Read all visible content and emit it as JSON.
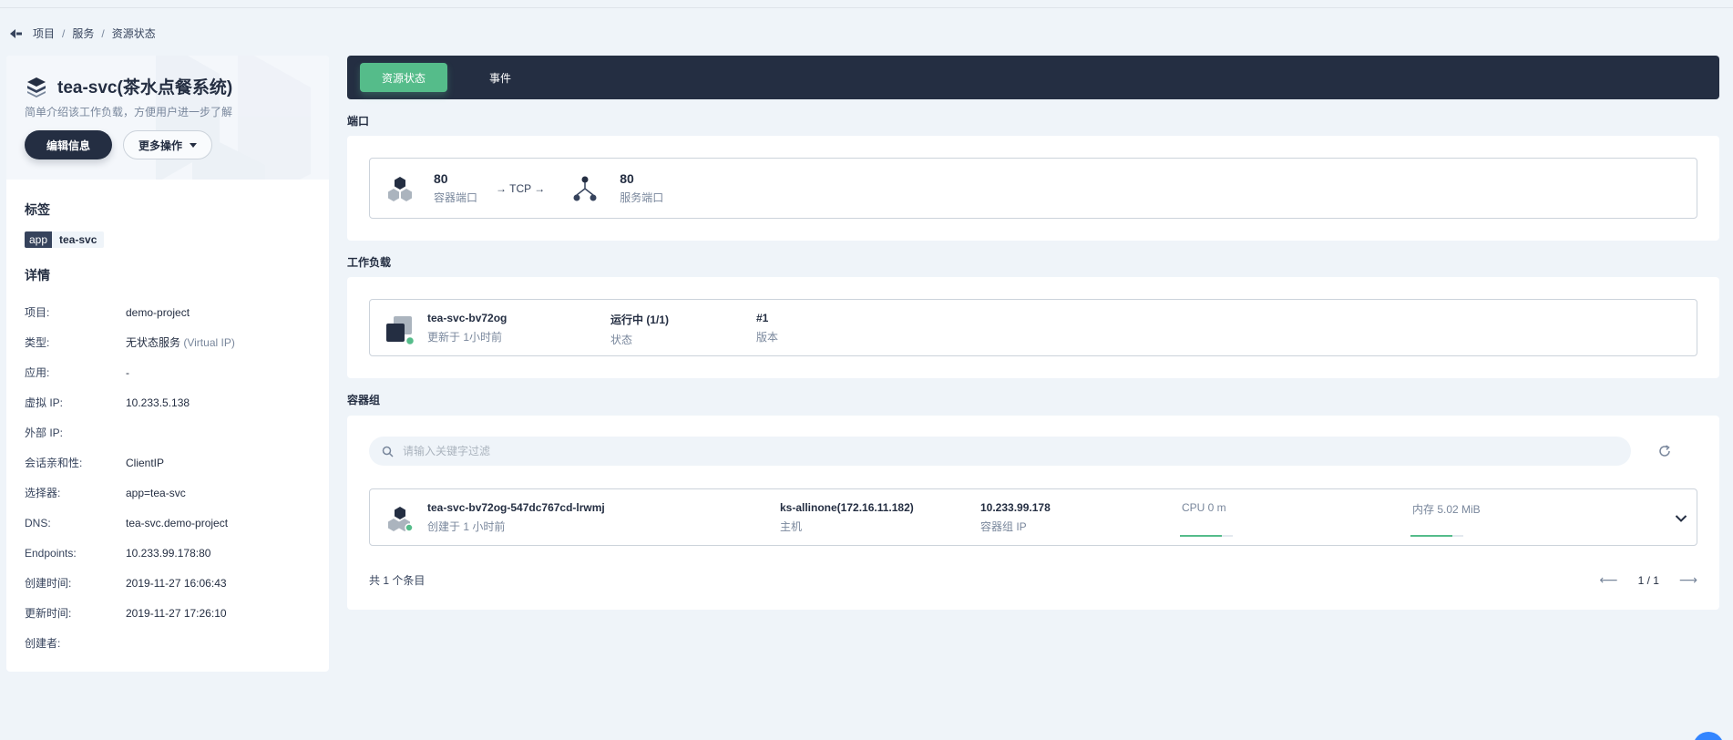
{
  "breadcrumb": {
    "items": [
      "项目",
      "服务",
      "资源状态"
    ],
    "sep": "/"
  },
  "service": {
    "name": "tea-svc(茶水点餐系统)",
    "description": "简单介绍该工作负载，方便用户进一步了解",
    "edit_label": "编辑信息",
    "more_label": "更多操作"
  },
  "labels": {
    "heading": "标签",
    "items": [
      {
        "key": "app",
        "value": "tea-svc"
      }
    ]
  },
  "details": {
    "heading": "详情",
    "rows": [
      {
        "label": "项目:",
        "value": "demo-project",
        "extra": ""
      },
      {
        "label": "类型:",
        "value": "无状态服务",
        "extra": "(Virtual IP)"
      },
      {
        "label": "应用:",
        "value": "-",
        "extra": ""
      },
      {
        "label": "虚拟 IP:",
        "value": "10.233.5.138",
        "extra": ""
      },
      {
        "label": "外部 IP:",
        "value": "",
        "extra": ""
      },
      {
        "label": "会话亲和性:",
        "value": "ClientIP",
        "extra": ""
      },
      {
        "label": "选择器:",
        "value": "app=tea-svc",
        "extra": ""
      },
      {
        "label": "DNS:",
        "value": "tea-svc.demo-project",
        "extra": ""
      },
      {
        "label": "Endpoints:",
        "value": "10.233.99.178:80",
        "extra": ""
      },
      {
        "label": "创建时间:",
        "value": "2019-11-27 16:06:43",
        "extra": ""
      },
      {
        "label": "更新时间:",
        "value": "2019-11-27 17:26:10",
        "extra": ""
      },
      {
        "label": "创建者:",
        "value": "",
        "extra": ""
      }
    ]
  },
  "tabs": {
    "active": "资源状态",
    "other": "事件"
  },
  "ports": {
    "heading": "端口",
    "container_port": "80",
    "container_port_label": "容器端口",
    "protocol": "→ TCP →",
    "service_port": "80",
    "service_port_label": "服务端口"
  },
  "workload": {
    "heading": "工作负载",
    "name": "tea-svc-bv72og",
    "updated": "更新于 1小时前",
    "status": "运行中 (1/1)",
    "status_label": "状态",
    "revision": "#1",
    "revision_label": "版本"
  },
  "pods": {
    "heading": "容器组",
    "search_placeholder": "请输入关键字过滤",
    "row": {
      "name": "tea-svc-bv72og-547dc767cd-lrwmj",
      "created": "创建于 1 小时前",
      "node": "ks-allinone(172.16.11.182)",
      "node_label": "主机",
      "ip": "10.233.99.178",
      "ip_label": "容器组 IP",
      "cpu": "CPU 0 m",
      "cpu_usage": 0.8,
      "memory": "内存 5.02 MiB",
      "memory_usage": 0.8
    },
    "total": "共 1 个条目",
    "page": "1 / 1"
  },
  "colors": {
    "dark": "#242e42",
    "accent": "#55bc8a",
    "bg": "#eff4f9"
  }
}
